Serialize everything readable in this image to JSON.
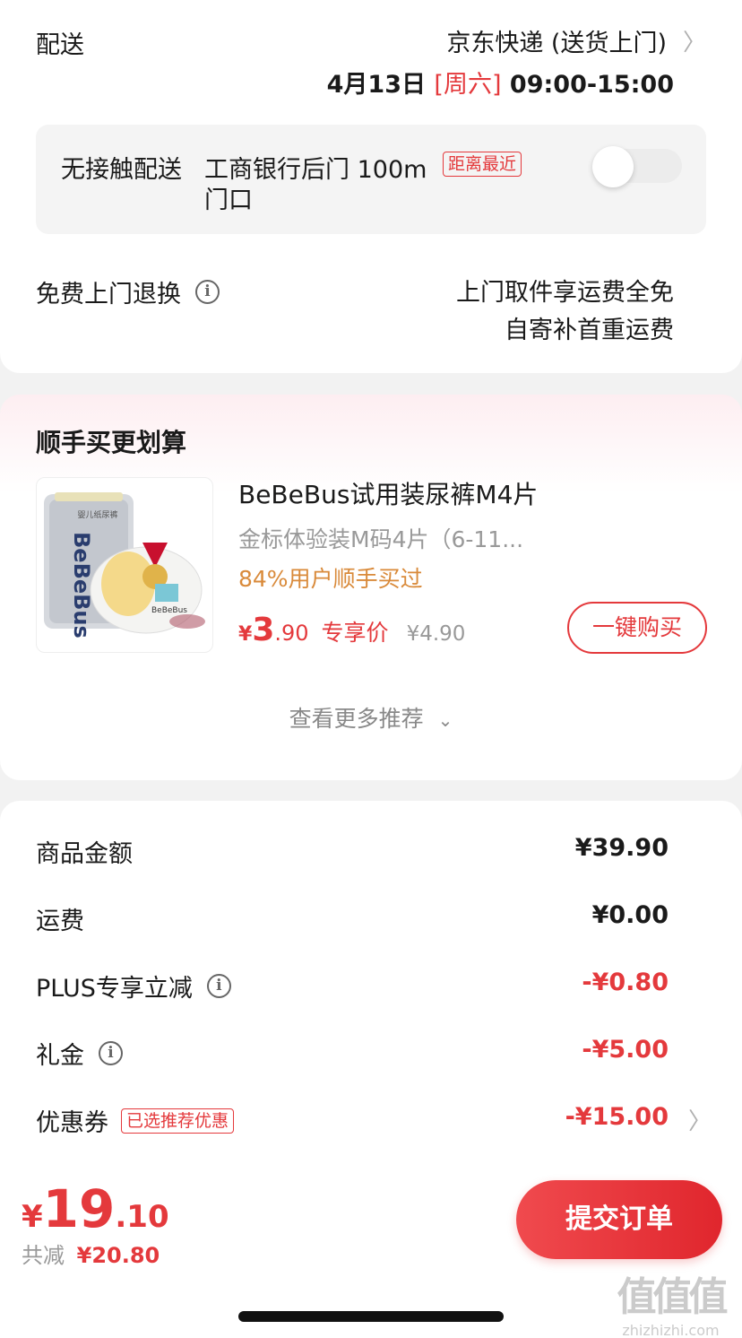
{
  "delivery": {
    "label": "配送",
    "carrier": "京东快递 (送货上门)",
    "date": "4月13日",
    "weekday": "[周六]",
    "time": "09:00-15:00",
    "contactless": {
      "label": "无接触配送",
      "location_line1": "工商银行后门 100m",
      "location_line2": "门口",
      "tag": "距离最近",
      "enabled": false
    },
    "returns": {
      "label": "免费上门退换",
      "line1": "上门取件享运费全免",
      "line2": "自寄补首重运费"
    }
  },
  "addon": {
    "title": "顺手买更划算",
    "product": {
      "name": "BeBeBus试用装尿裤M4片",
      "spec": "金标体验装M码4片（6-11...",
      "social_proof": "84%用户顺手买过",
      "price_symbol": "¥",
      "price_int": "3",
      "price_dec": ".90",
      "price_label": "专享价",
      "original_price": "¥4.90",
      "buy_label": "一键购买",
      "image_brand": "BeBeBus",
      "image_pack_text": "婴儿纸尿裤"
    },
    "more_label": "查看更多推荐"
  },
  "summary": {
    "rows": [
      {
        "label": "商品金额",
        "amount": "¥39.90",
        "info": false,
        "red": false
      },
      {
        "label": "运费",
        "amount": "¥0.00",
        "info": false,
        "red": false
      },
      {
        "label": "PLUS专享立减",
        "amount": "-¥0.80",
        "info": true,
        "red": true
      },
      {
        "label": "礼金",
        "amount": "-¥5.00",
        "info": true,
        "red": true
      },
      {
        "label": "优惠券",
        "amount": "-¥15.00",
        "info": false,
        "red": true,
        "tag": "已选推荐优惠",
        "chevron": true
      }
    ]
  },
  "footer": {
    "total_symbol": "¥",
    "total_int": "19",
    "total_dec": ".10",
    "saved_label": "共减",
    "saved_amount": "¥20.80",
    "submit_label": "提交订单"
  },
  "watermark": {
    "logo": "值值值",
    "domain": "zhizhizhi.com"
  },
  "colors": {
    "accent_red": "#e4393c",
    "orange": "#d98a3a",
    "gray_text": "#999999"
  }
}
